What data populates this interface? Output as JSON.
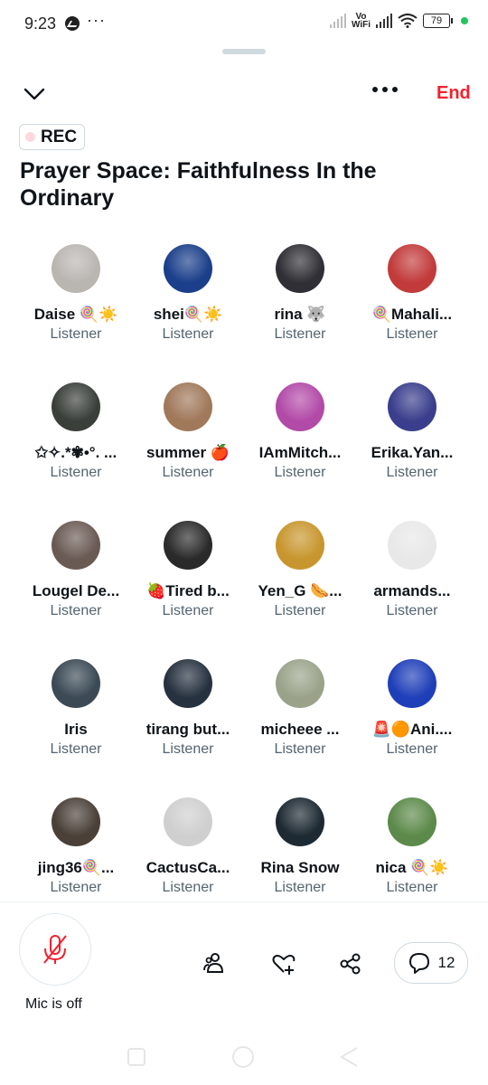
{
  "status_bar": {
    "time": "9:23",
    "network_label": "Vo\nWiFi",
    "battery": "79"
  },
  "header": {
    "end_label": "End"
  },
  "space": {
    "rec_label": "REC",
    "title": "Prayer Space: Faithfulness In the Ordinary"
  },
  "listeners": [
    {
      "name": "Daise 🍭☀️",
      "role": "Listener",
      "color": "#b9b6b2"
    },
    {
      "name": "shei🍭☀️",
      "role": "Listener",
      "color": "#1b3f8a"
    },
    {
      "name": "rina 🐺",
      "role": "Listener",
      "color": "#2f2f35"
    },
    {
      "name": "🍭Mahali...",
      "role": "Listener",
      "color": "#c23b3b"
    },
    {
      "name": "✩✧.*✾•°. ...",
      "role": "Listener",
      "color": "#3a3f3a"
    },
    {
      "name": "summer 🍎",
      "role": "Listener",
      "color": "#a0785a"
    },
    {
      "name": "IAmMitch...",
      "role": "Listener",
      "color": "#b24aa8"
    },
    {
      "name": "Erika.Yan...",
      "role": "Listener",
      "color": "#3a3e8c"
    },
    {
      "name": "Lougel De...",
      "role": "Listener",
      "color": "#6a5a54"
    },
    {
      "name": "🍓Tired b...",
      "role": "Listener",
      "color": "#2a2a2a"
    },
    {
      "name": "Yen_G 🌭...",
      "role": "Listener",
      "color": "#c8962e"
    },
    {
      "name": "armands...",
      "role": "Listener",
      "color": "#e8e8e8"
    },
    {
      "name": "Iris",
      "role": "Listener",
      "color": "#3b4a55"
    },
    {
      "name": "tirang but...",
      "role": "Listener",
      "color": "#273240"
    },
    {
      "name": "micheee ...",
      "role": "Listener",
      "color": "#9aa38a"
    },
    {
      "name": "🚨🟠Ani....",
      "role": "Listener",
      "color": "#1f3fb8"
    },
    {
      "name": "jing36🍭...",
      "role": "Listener",
      "color": "#4a4038"
    },
    {
      "name": "CactusCa...",
      "role": "Listener",
      "color": "#cfcfcf"
    },
    {
      "name": "Rina Snow",
      "role": "Listener",
      "color": "#1e2a33"
    },
    {
      "name": "nica 🍭☀️",
      "role": "Listener",
      "color": "#5c8a4a"
    }
  ],
  "footer": {
    "mic_label": "Mic is off",
    "comment_count": "12"
  },
  "colors": {
    "end": "#f4212e",
    "secondary_text": "#536471",
    "mic_off": "#f4212e"
  }
}
